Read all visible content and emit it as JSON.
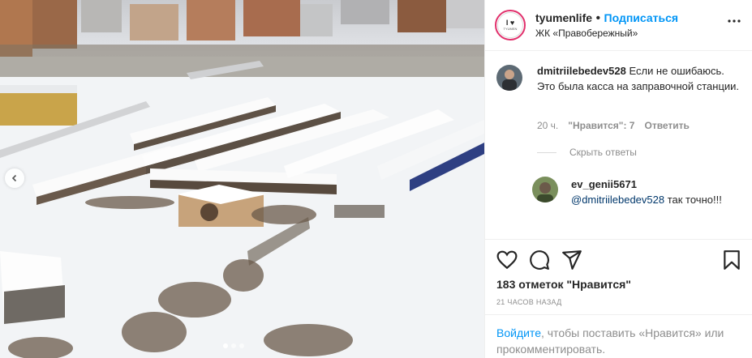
{
  "post": {
    "username": "tyumenlife",
    "separator": "•",
    "follow_label": "Подписаться",
    "location": "ЖК «Правобережный»",
    "logo_mark": "I ♥",
    "logo_text": "TYUMEN"
  },
  "comments": [
    {
      "username": "dmitriilebedev528",
      "text": "Если не ошибаюсь. Это была касса на заправочной станции.",
      "time": "20 ч.",
      "likes": "\"Нравится\": 7",
      "reply_label": "Ответить"
    }
  ],
  "hide_replies_label": "Скрыть ответы",
  "reply": {
    "username": "ev_genii5671",
    "mention": "@dmitriilebedev528",
    "text": " так точно!!!"
  },
  "likes_count": "183 отметок \"Нравится\"",
  "timestamp": "21 ЧАСОВ НАЗАД",
  "login_prompt": {
    "link": "Войдите",
    "text": ", чтобы поставить «Нравится» или прокомментировать."
  },
  "carousel": {
    "total": 3,
    "active_index": 0
  },
  "colors": {
    "accent": "#0095f6",
    "text": "#262626",
    "muted": "#8e8e8e",
    "mention": "#00376b"
  }
}
